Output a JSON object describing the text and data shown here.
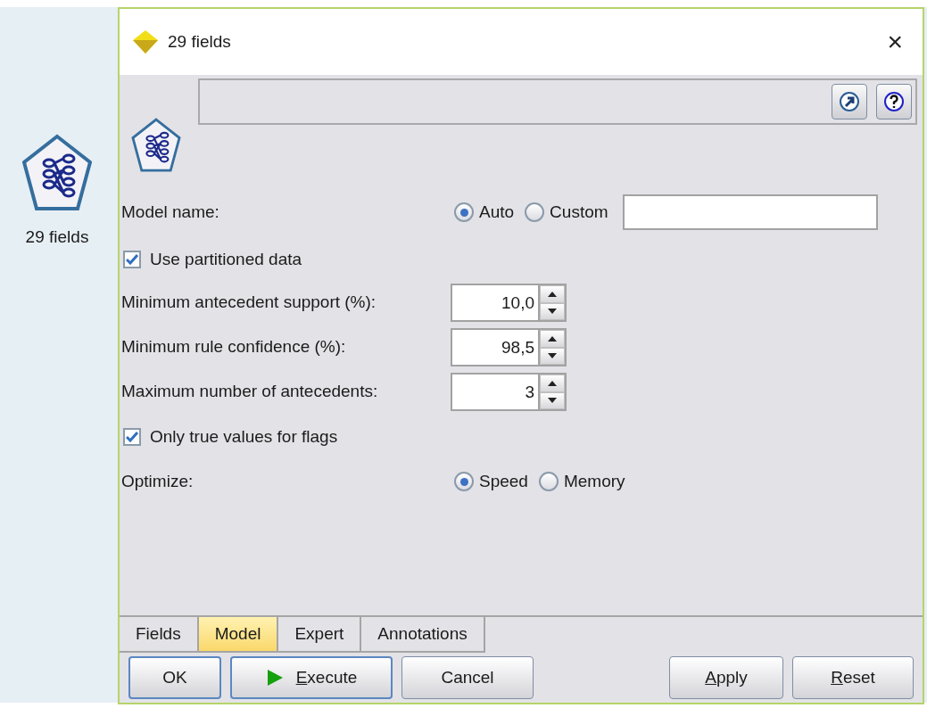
{
  "canvas_node": {
    "label": "29 fields"
  },
  "window": {
    "title": "29 fields",
    "close": "×"
  },
  "header": {
    "buttons": [
      {
        "kind": "launch"
      },
      {
        "kind": "help"
      }
    ]
  },
  "model_name": {
    "label": "Model name:",
    "options": [
      {
        "label": "Auto",
        "selected": true
      },
      {
        "label": "Custom",
        "selected": false
      }
    ]
  },
  "use_partitioned_data": {
    "label": "Use partitioned data",
    "checked": true
  },
  "spinners": [
    {
      "label": "Minimum antecedent support (%):",
      "value": "10,0"
    },
    {
      "label": "Minimum rule confidence (%):",
      "value": "98,5"
    },
    {
      "label": "Maximum number of antecedents:",
      "value": "3"
    }
  ],
  "only_true_values": {
    "label": "Only true values for flags",
    "checked": true
  },
  "optimize": {
    "label": "Optimize:",
    "options": [
      {
        "label": "Speed",
        "selected": true
      },
      {
        "label": "Memory",
        "selected": false
      }
    ]
  },
  "tabs": [
    {
      "label": "Fields",
      "selected": false
    },
    {
      "label": "Model",
      "selected": true
    },
    {
      "label": "Expert",
      "selected": false
    },
    {
      "label": "Annotations",
      "selected": false
    }
  ],
  "buttons": [
    {
      "label": "OK",
      "kind": "default",
      "mnemonic": false
    },
    {
      "label": "Execute",
      "kind": "run",
      "mnemonic": true
    },
    {
      "label": "Cancel",
      "kind": "plain",
      "mnemonic": false
    },
    {
      "label": "Apply",
      "kind": "plain",
      "mnemonic": true
    },
    {
      "label": "Reset",
      "kind": "plain",
      "mnemonic": true
    }
  ]
}
